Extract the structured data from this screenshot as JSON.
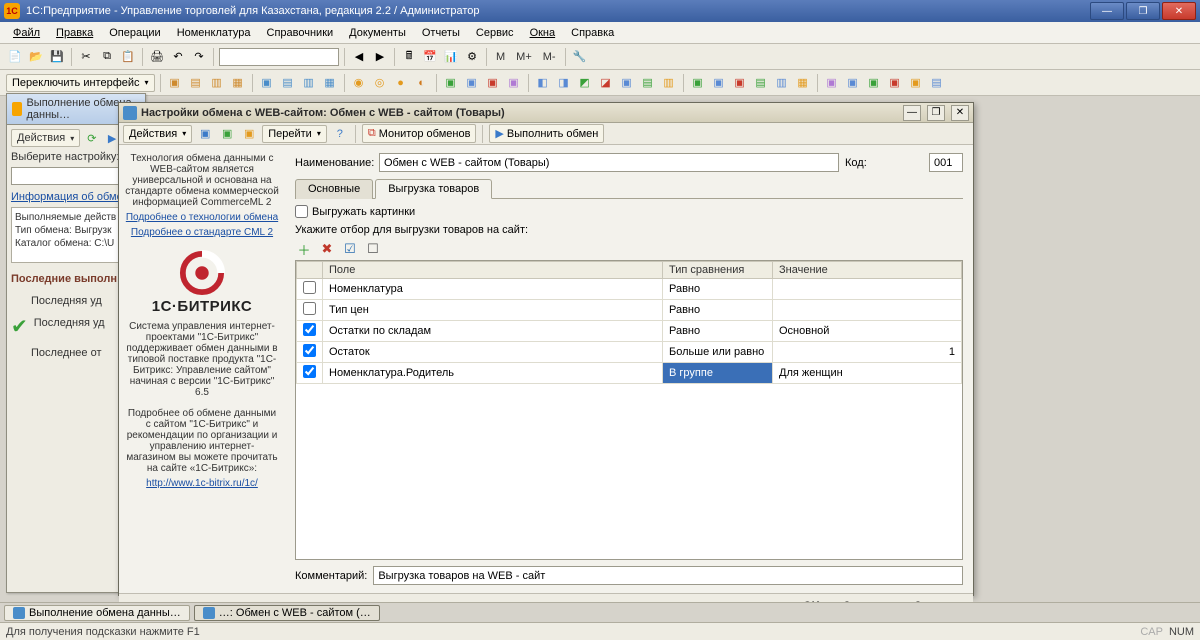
{
  "window_title": "1С:Предприятие - Управление торговлей для Казахстана, редакция 2.2 / Администратор",
  "menu": {
    "file": "Файл",
    "edit": "Правка",
    "ops": "Операции",
    "nomen": "Номенклатура",
    "refs": "Справочники",
    "docs": "Документы",
    "reps": "Отчеты",
    "service": "Сервис",
    "wins": "Окна",
    "help": "Справка"
  },
  "toolbar": {
    "m": "M",
    "mplus": "M+",
    "mminus": "M-",
    "switch_ui": "Переключить интерфейс"
  },
  "back_window": {
    "title": "Выполнение обмена данны…",
    "actions": "Действия",
    "select_setting": "Выберите настройку:",
    "info_label": "Информация об обмен",
    "line1": "Выполняемые действ",
    "line2": "Тип обмена:  Выгрузк",
    "line3": "Каталог обмена: C:\\U",
    "recent": "Последние выполн",
    "last_ok": "Последняя уд",
    "last_ok2": "Последняя уд",
    "last_err": "Последнее от"
  },
  "dialog": {
    "title": "Настройки обмена с WEB-сайтом: Обмен с WEB - сайтом (Товары)",
    "tb": {
      "actions": "Действия",
      "goto": "Перейти",
      "monitor": "Монитор обменов",
      "run": "Выполнить обмен"
    },
    "left": {
      "intro": "Технология обмена данными с WEB-сайтом является универсальной и основана на стандарте обмена коммерческой информацией CommerceML 2",
      "link1": "Подробнее о технологии обмена",
      "link2": "Подробнее о стандарте CML 2",
      "brand": "1С·БИТРИКС",
      "desc1": "Система управления интернет-проектами \"1С-Битрикс\" поддерживает обмен данными в типовой поставке продукта \"1С-Битрикс: Управление сайтом\" начиная с версии \"1С-Битрикс\" 6.5",
      "desc2": "Подробнее об обмене данными с сайтом \"1С-Битрикс\" и рекомендации по организации и управлению интернет-магазином вы можете прочитать на сайте «1С-Битрикс»:",
      "url": "http://www.1c-bitrix.ru/1c/"
    },
    "name_label": "Наименование:",
    "name_value": "Обмен с WEB - сайтом (Товары)",
    "code_label": "Код:",
    "code_value": "001",
    "tab_main": "Основные",
    "tab_export": "Выгрузка товаров",
    "chk_images": "Выгружать картинки",
    "filter_hint": "Укажите отбор для выгрузки товаров на сайт:",
    "cols": {
      "field": "Поле",
      "cmp": "Тип сравнения",
      "val": "Значение"
    },
    "rows": [
      {
        "on": false,
        "field": "Номенклатура",
        "cmp": "Равно",
        "val": ""
      },
      {
        "on": false,
        "field": "Тип цен",
        "cmp": "Равно",
        "val": ""
      },
      {
        "on": true,
        "field": "Остатки по складам",
        "cmp": "Равно",
        "val": "Основной"
      },
      {
        "on": true,
        "field": "Остаток",
        "cmp": "Больше или равно",
        "val": "1",
        "right": true
      },
      {
        "on": true,
        "field": "Номенклатура.Родитель",
        "cmp": "В группе",
        "val": "Для женщин",
        "sel": true
      }
    ],
    "comment_label": "Комментарий:",
    "comment_value": "Выгрузка товаров на WEB - сайт",
    "btn_ok": "OK",
    "btn_save": "Записать",
    "btn_close": "Закрыть"
  },
  "taskbar": {
    "t1": "Выполнение обмена данны…",
    "t2": "…: Обмен с WEB - сайтом (…"
  },
  "status": {
    "hint": "Для получения подсказки нажмите F1",
    "cap": "CAP",
    "num": "NUM"
  }
}
